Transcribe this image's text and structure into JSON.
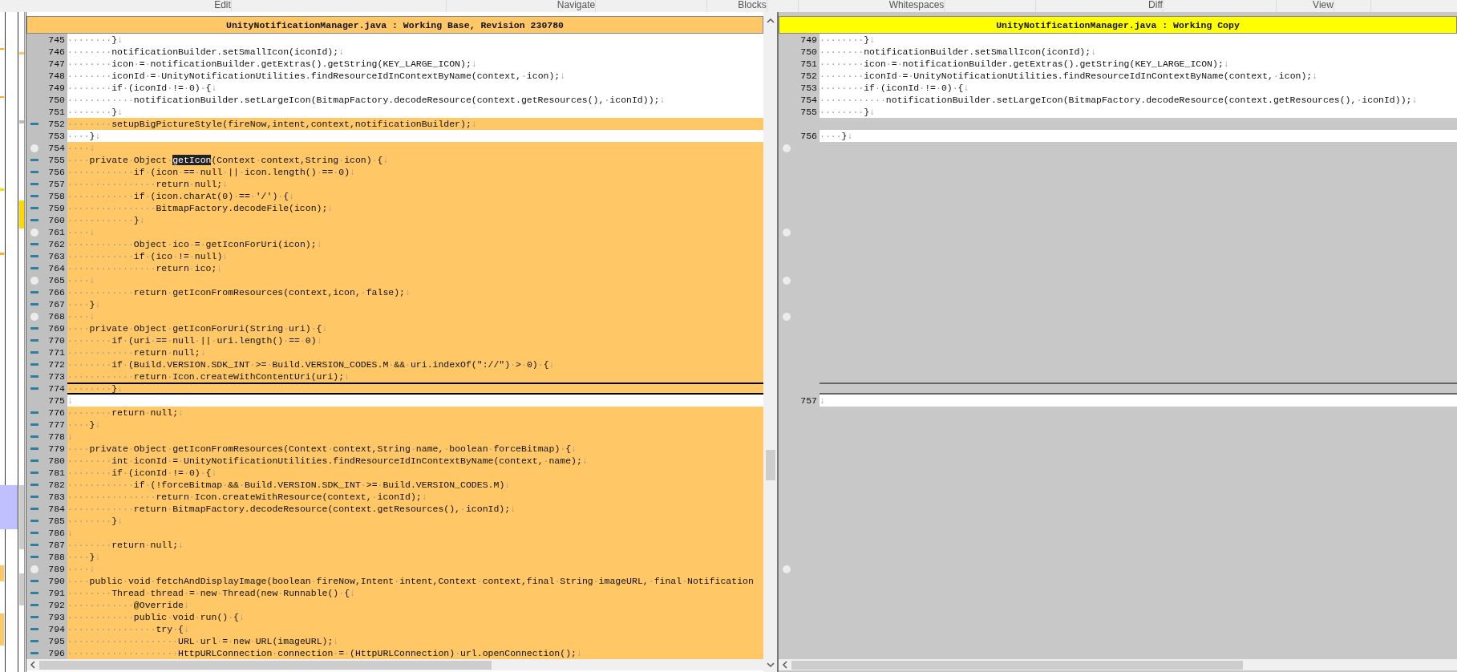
{
  "menu_tabs": [
    {
      "label": "Edit"
    },
    {
      "label": "Navigate"
    },
    {
      "label": "Blocks"
    },
    {
      "label": "Whitespaces"
    },
    {
      "label": "Diff"
    },
    {
      "label": "View"
    }
  ],
  "panes": [
    {
      "title": "UnityNotificationManager.java : Working Base, Revision 230780",
      "color": "#ffc766"
    },
    {
      "title": "UnityNotificationManager.java : Working Copy",
      "color": "#ffff00"
    }
  ],
  "rows": [
    {
      "current": false,
      "left": {
        "number": "745",
        "code": "········}↓",
        "changed": false,
        "kind": "plain"
      },
      "right": {
        "kind": "line",
        "number": "749",
        "code": "········}↓"
      }
    },
    {
      "current": false,
      "left": {
        "number": "746",
        "code": "········notificationBuilder.setSmallIcon(iconId);↓",
        "changed": false,
        "kind": "plain"
      },
      "right": {
        "kind": "line",
        "number": "750",
        "code": "········notificationBuilder.setSmallIcon(iconId);↓"
      }
    },
    {
      "current": false,
      "left": {
        "number": "747",
        "code": "········icon·=·notificationBuilder.getExtras().getString(KEY_LARGE_ICON);↓",
        "changed": false,
        "kind": "plain"
      },
      "right": {
        "kind": "line",
        "number": "751",
        "code": "········icon·=·notificationBuilder.getExtras().getString(KEY_LARGE_ICON);↓"
      }
    },
    {
      "current": false,
      "left": {
        "number": "748",
        "code": "········iconId·=·UnityNotificationUtilities.findResourceIdInContextByName(context,·icon);↓",
        "changed": false,
        "kind": "plain"
      },
      "right": {
        "kind": "line",
        "number": "752",
        "code": "········iconId·=·UnityNotificationUtilities.findResourceIdInContextByName(context,·icon);↓"
      }
    },
    {
      "current": false,
      "left": {
        "number": "749",
        "code": "········if·(iconId·!=·0)·{↓",
        "changed": false,
        "kind": "plain"
      },
      "right": {
        "kind": "line",
        "number": "753",
        "code": "········if·(iconId·!=·0)·{↓"
      }
    },
    {
      "current": false,
      "left": {
        "number": "750",
        "code": "············notificationBuilder.setLargeIcon(BitmapFactory.decodeResource(context.getResources(),·iconId));↓",
        "changed": false,
        "kind": "plain"
      },
      "right": {
        "kind": "line",
        "number": "754",
        "code": "············notificationBuilder.setLargeIcon(BitmapFactory.decodeResource(context.getResources(),·iconId));↓"
      }
    },
    {
      "current": false,
      "left": {
        "number": "751",
        "code": "········}↓",
        "changed": false,
        "kind": "plain"
      },
      "right": {
        "kind": "line",
        "number": "755",
        "code": "········}↓"
      }
    },
    {
      "current": false,
      "left": {
        "number": "752",
        "code": "········setupBigPictureStyle(fireNow,intent,context,notificationBuilder);↓",
        "changed": true,
        "kind": "dash"
      },
      "right": {
        "kind": "gap"
      }
    },
    {
      "current": false,
      "left": {
        "number": "753",
        "code": "····}↓",
        "changed": false,
        "kind": "plain"
      },
      "right": {
        "kind": "line",
        "number": "756",
        "code": "····}↓"
      }
    },
    {
      "current": false,
      "left": {
        "number": "754",
        "code": "····↓",
        "changed": true,
        "kind": "circle"
      },
      "right": {
        "kind": "marked_gap"
      }
    },
    {
      "current": false,
      "left": {
        "number": "755",
        "segments": [
          {
            "text": "····private·Object·",
            "selected": false
          },
          {
            "text": "getIcon",
            "selected": true
          },
          {
            "text": "(Context·context,String·icon)·{↓",
            "selected": false
          }
        ],
        "changed": true,
        "kind": "dash"
      },
      "right": {
        "kind": "gap"
      }
    },
    {
      "current": false,
      "left": {
        "number": "756",
        "code": "············if·(icon·==·null·||·icon.length()·==·0)↓",
        "changed": true,
        "kind": "dash"
      },
      "right": {
        "kind": "gap"
      }
    },
    {
      "current": false,
      "left": {
        "number": "757",
        "code": "················return·null;↓",
        "changed": true,
        "kind": "dash"
      },
      "right": {
        "kind": "gap"
      }
    },
    {
      "current": false,
      "left": {
        "number": "758",
        "code": "············if·(icon.charAt(0)·==·'/')·{↓",
        "changed": true,
        "kind": "dash"
      },
      "right": {
        "kind": "gap"
      }
    },
    {
      "current": false,
      "left": {
        "number": "759",
        "code": "················BitmapFactory.decodeFile(icon);↓",
        "changed": true,
        "kind": "dash"
      },
      "right": {
        "kind": "gap"
      }
    },
    {
      "current": false,
      "left": {
        "number": "760",
        "code": "············}↓",
        "changed": true,
        "kind": "dash"
      },
      "right": {
        "kind": "gap"
      }
    },
    {
      "current": false,
      "left": {
        "number": "761",
        "code": "····↓",
        "changed": true,
        "kind": "circle"
      },
      "right": {
        "kind": "marked_gap"
      }
    },
    {
      "current": false,
      "left": {
        "number": "762",
        "code": "············Object·ico·=·getIconForUri(icon);↓",
        "changed": true,
        "kind": "dash"
      },
      "right": {
        "kind": "gap"
      }
    },
    {
      "current": false,
      "left": {
        "number": "763",
        "code": "············if·(ico·!=·null)↓",
        "changed": true,
        "kind": "dash"
      },
      "right": {
        "kind": "gap"
      }
    },
    {
      "current": false,
      "left": {
        "number": "764",
        "code": "················return·ico;↓",
        "changed": true,
        "kind": "dash"
      },
      "right": {
        "kind": "gap"
      }
    },
    {
      "current": false,
      "left": {
        "number": "765",
        "code": "····↓",
        "changed": true,
        "kind": "circle"
      },
      "right": {
        "kind": "marked_gap"
      }
    },
    {
      "current": false,
      "left": {
        "number": "766",
        "code": "············return·getIconFromResources(context,icon,·false);↓",
        "changed": true,
        "kind": "dash"
      },
      "right": {
        "kind": "gap"
      }
    },
    {
      "current": false,
      "left": {
        "number": "767",
        "code": "····}↓",
        "changed": true,
        "kind": "dash"
      },
      "right": {
        "kind": "gap"
      }
    },
    {
      "current": false,
      "left": {
        "number": "768",
        "code": "····↓",
        "changed": true,
        "kind": "circle"
      },
      "right": {
        "kind": "marked_gap"
      }
    },
    {
      "current": false,
      "left": {
        "number": "769",
        "code": "····private·Object·getIconForUri(String·uri)·{↓",
        "changed": true,
        "kind": "dash"
      },
      "right": {
        "kind": "gap"
      }
    },
    {
      "current": false,
      "left": {
        "number": "770",
        "code": "········if·(uri·==·null·||·uri.length()·==·0)↓",
        "changed": true,
        "kind": "dash"
      },
      "right": {
        "kind": "gap"
      }
    },
    {
      "current": false,
      "left": {
        "number": "771",
        "code": "············return·null;↓",
        "changed": true,
        "kind": "dash"
      },
      "right": {
        "kind": "gap"
      }
    },
    {
      "current": false,
      "left": {
        "number": "772",
        "code": "········if·(Build.VERSION.SDK_INT·>=·Build.VERSION_CODES.M·&&·uri.indexOf(\"://\")·>·0)·{↓",
        "changed": true,
        "kind": "dash"
      },
      "right": {
        "kind": "gap"
      }
    },
    {
      "current": false,
      "left": {
        "number": "773",
        "code": "············return·Icon.createWithContentUri(uri);↓",
        "changed": true,
        "kind": "dash"
      },
      "right": {
        "kind": "gap"
      }
    },
    {
      "current": true,
      "left": {
        "number": "774",
        "code": "········}↓",
        "changed": true,
        "kind": "dash"
      },
      "right": {
        "kind": "gap"
      }
    },
    {
      "current": false,
      "left": {
        "number": "775",
        "code": "↓",
        "changed": false,
        "kind": "plain"
      },
      "right": {
        "kind": "line",
        "number": "757",
        "code": "↓"
      }
    },
    {
      "current": false,
      "left": {
        "number": "776",
        "code": "········return·null;↓",
        "changed": true,
        "kind": "dash"
      },
      "right": {
        "kind": "gap"
      }
    },
    {
      "current": false,
      "left": {
        "number": "777",
        "code": "····}↓",
        "changed": true,
        "kind": "dash"
      },
      "right": {
        "kind": "gap"
      }
    },
    {
      "current": false,
      "left": {
        "number": "778",
        "code": "↓",
        "changed": true,
        "kind": "dash"
      },
      "right": {
        "kind": "gap"
      }
    },
    {
      "current": false,
      "left": {
        "number": "779",
        "code": "····private·Object·getIconFromResources(Context·context,String·name,·boolean·forceBitmap)·{↓",
        "changed": true,
        "kind": "dash"
      },
      "right": {
        "kind": "gap"
      }
    },
    {
      "current": false,
      "left": {
        "number": "780",
        "code": "········int·iconId·=·UnityNotificationUtilities.findResourceIdInContextByName(context,·name);↓",
        "changed": true,
        "kind": "dash"
      },
      "right": {
        "kind": "gap"
      }
    },
    {
      "current": false,
      "left": {
        "number": "781",
        "code": "········if·(iconId·!=·0)·{↓",
        "changed": true,
        "kind": "dash"
      },
      "right": {
        "kind": "gap"
      }
    },
    {
      "current": false,
      "left": {
        "number": "782",
        "code": "············if·(!forceBitmap·&&·Build.VERSION.SDK_INT·>=·Build.VERSION_CODES.M)↓",
        "changed": true,
        "kind": "dash"
      },
      "right": {
        "kind": "gap"
      }
    },
    {
      "current": false,
      "left": {
        "number": "783",
        "code": "················return·Icon.createWithResource(context,·iconId);↓",
        "changed": true,
        "kind": "dash"
      },
      "right": {
        "kind": "gap"
      }
    },
    {
      "current": false,
      "left": {
        "number": "784",
        "code": "············return·BitmapFactory.decodeResource(context.getResources(),·iconId);↓",
        "changed": true,
        "kind": "dash"
      },
      "right": {
        "kind": "gap"
      }
    },
    {
      "current": false,
      "left": {
        "number": "785",
        "code": "········}↓",
        "changed": true,
        "kind": "dash"
      },
      "right": {
        "kind": "gap"
      }
    },
    {
      "current": false,
      "left": {
        "number": "786",
        "code": "↓",
        "changed": true,
        "kind": "dash"
      },
      "right": {
        "kind": "gap"
      }
    },
    {
      "current": false,
      "left": {
        "number": "787",
        "code": "········return·null;↓",
        "changed": true,
        "kind": "dash"
      },
      "right": {
        "kind": "gap"
      }
    },
    {
      "current": false,
      "left": {
        "number": "788",
        "code": "····}↓",
        "changed": true,
        "kind": "dash"
      },
      "right": {
        "kind": "gap"
      }
    },
    {
      "current": false,
      "left": {
        "number": "789",
        "code": "····↓",
        "changed": true,
        "kind": "circle"
      },
      "right": {
        "kind": "marked_gap"
      }
    },
    {
      "current": false,
      "left": {
        "number": "790",
        "code": "····public·void·fetchAndDisplayImage(boolean·fireNow,Intent·intent,Context·context,final·String·imageURL,·final·Notification",
        "changed": true,
        "kind": "dash"
      },
      "right": {
        "kind": "gap"
      }
    },
    {
      "current": false,
      "left": {
        "number": "791",
        "code": "········Thread·thread·=·new·Thread(new·Runnable()·{↓",
        "changed": true,
        "kind": "dash"
      },
      "right": {
        "kind": "gap"
      }
    },
    {
      "current": false,
      "left": {
        "number": "792",
        "code": "············@Override↓",
        "changed": true,
        "kind": "dash"
      },
      "right": {
        "kind": "gap"
      }
    },
    {
      "current": false,
      "left": {
        "number": "793",
        "code": "············public·void·run()·{↓",
        "changed": true,
        "kind": "dash"
      },
      "right": {
        "kind": "gap"
      }
    },
    {
      "current": false,
      "left": {
        "number": "794",
        "code": "················try·{↓",
        "changed": true,
        "kind": "dash"
      },
      "right": {
        "kind": "gap"
      }
    },
    {
      "current": false,
      "left": {
        "number": "795",
        "code": "····················URL·url·=·new·URL(imageURL);↓",
        "changed": true,
        "kind": "dash"
      },
      "right": {
        "kind": "gap"
      }
    },
    {
      "current": false,
      "left": {
        "number": "796",
        "code": "····················HttpURLConnection·connection·=·(HttpURLConnection)·url.openConnection();↓",
        "changed": true,
        "kind": "dash"
      },
      "right": {
        "kind": "gap"
      }
    }
  ]
}
